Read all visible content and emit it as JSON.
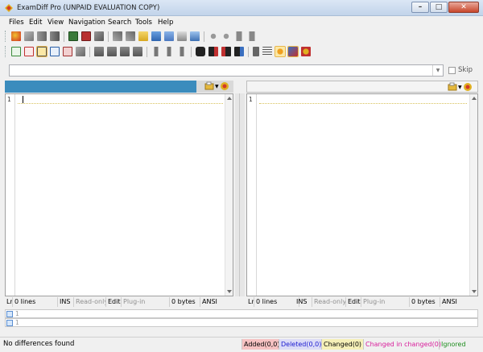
{
  "window": {
    "title": "ExamDiff Pro (UNPAID EVALUATION COPY)"
  },
  "menu": [
    "Files",
    "Edit",
    "View",
    "Navigation",
    "Search",
    "Tools",
    "Help"
  ],
  "filter": {
    "skip_label": "Skip"
  },
  "left_pane": {
    "line_number": "1"
  },
  "right_pane": {
    "line_number": "1"
  },
  "left_info": {
    "lines": "0 lines",
    "ins": "INS",
    "readonly": "Read-only",
    "edit": "Edit",
    "plugin": "Plug-in",
    "size": "0 bytes",
    "encoding": "ANSI",
    "prefix": "Lr"
  },
  "right_info": {
    "lines": "0 lines",
    "ins": "INS",
    "readonly": "Read-only",
    "edit": "Edit",
    "plugin": "Plug-in",
    "size": "0 bytes",
    "encoding": "ANSI",
    "prefix": "Lr"
  },
  "compare_rows": {
    "row1": "1",
    "row2": "1"
  },
  "status": {
    "message": "No differences found",
    "added": "Added(0,0)",
    "deleted": "Deleted(0,0)",
    "changed": "Changed(0)",
    "changed_in_changed": "Changed in changed(0)",
    "ignored": "Ignored"
  },
  "colors": {
    "added_bg": "#f6c2c2",
    "deleted_bg": "#dcdcf7",
    "changed_bg": "#f6f0b8",
    "changed_in_changed_text": "#d81b9a",
    "ignored_text": "#1c8c1c",
    "deleted_text": "#1a1ad0",
    "header_blue": "#3b8cbd"
  }
}
